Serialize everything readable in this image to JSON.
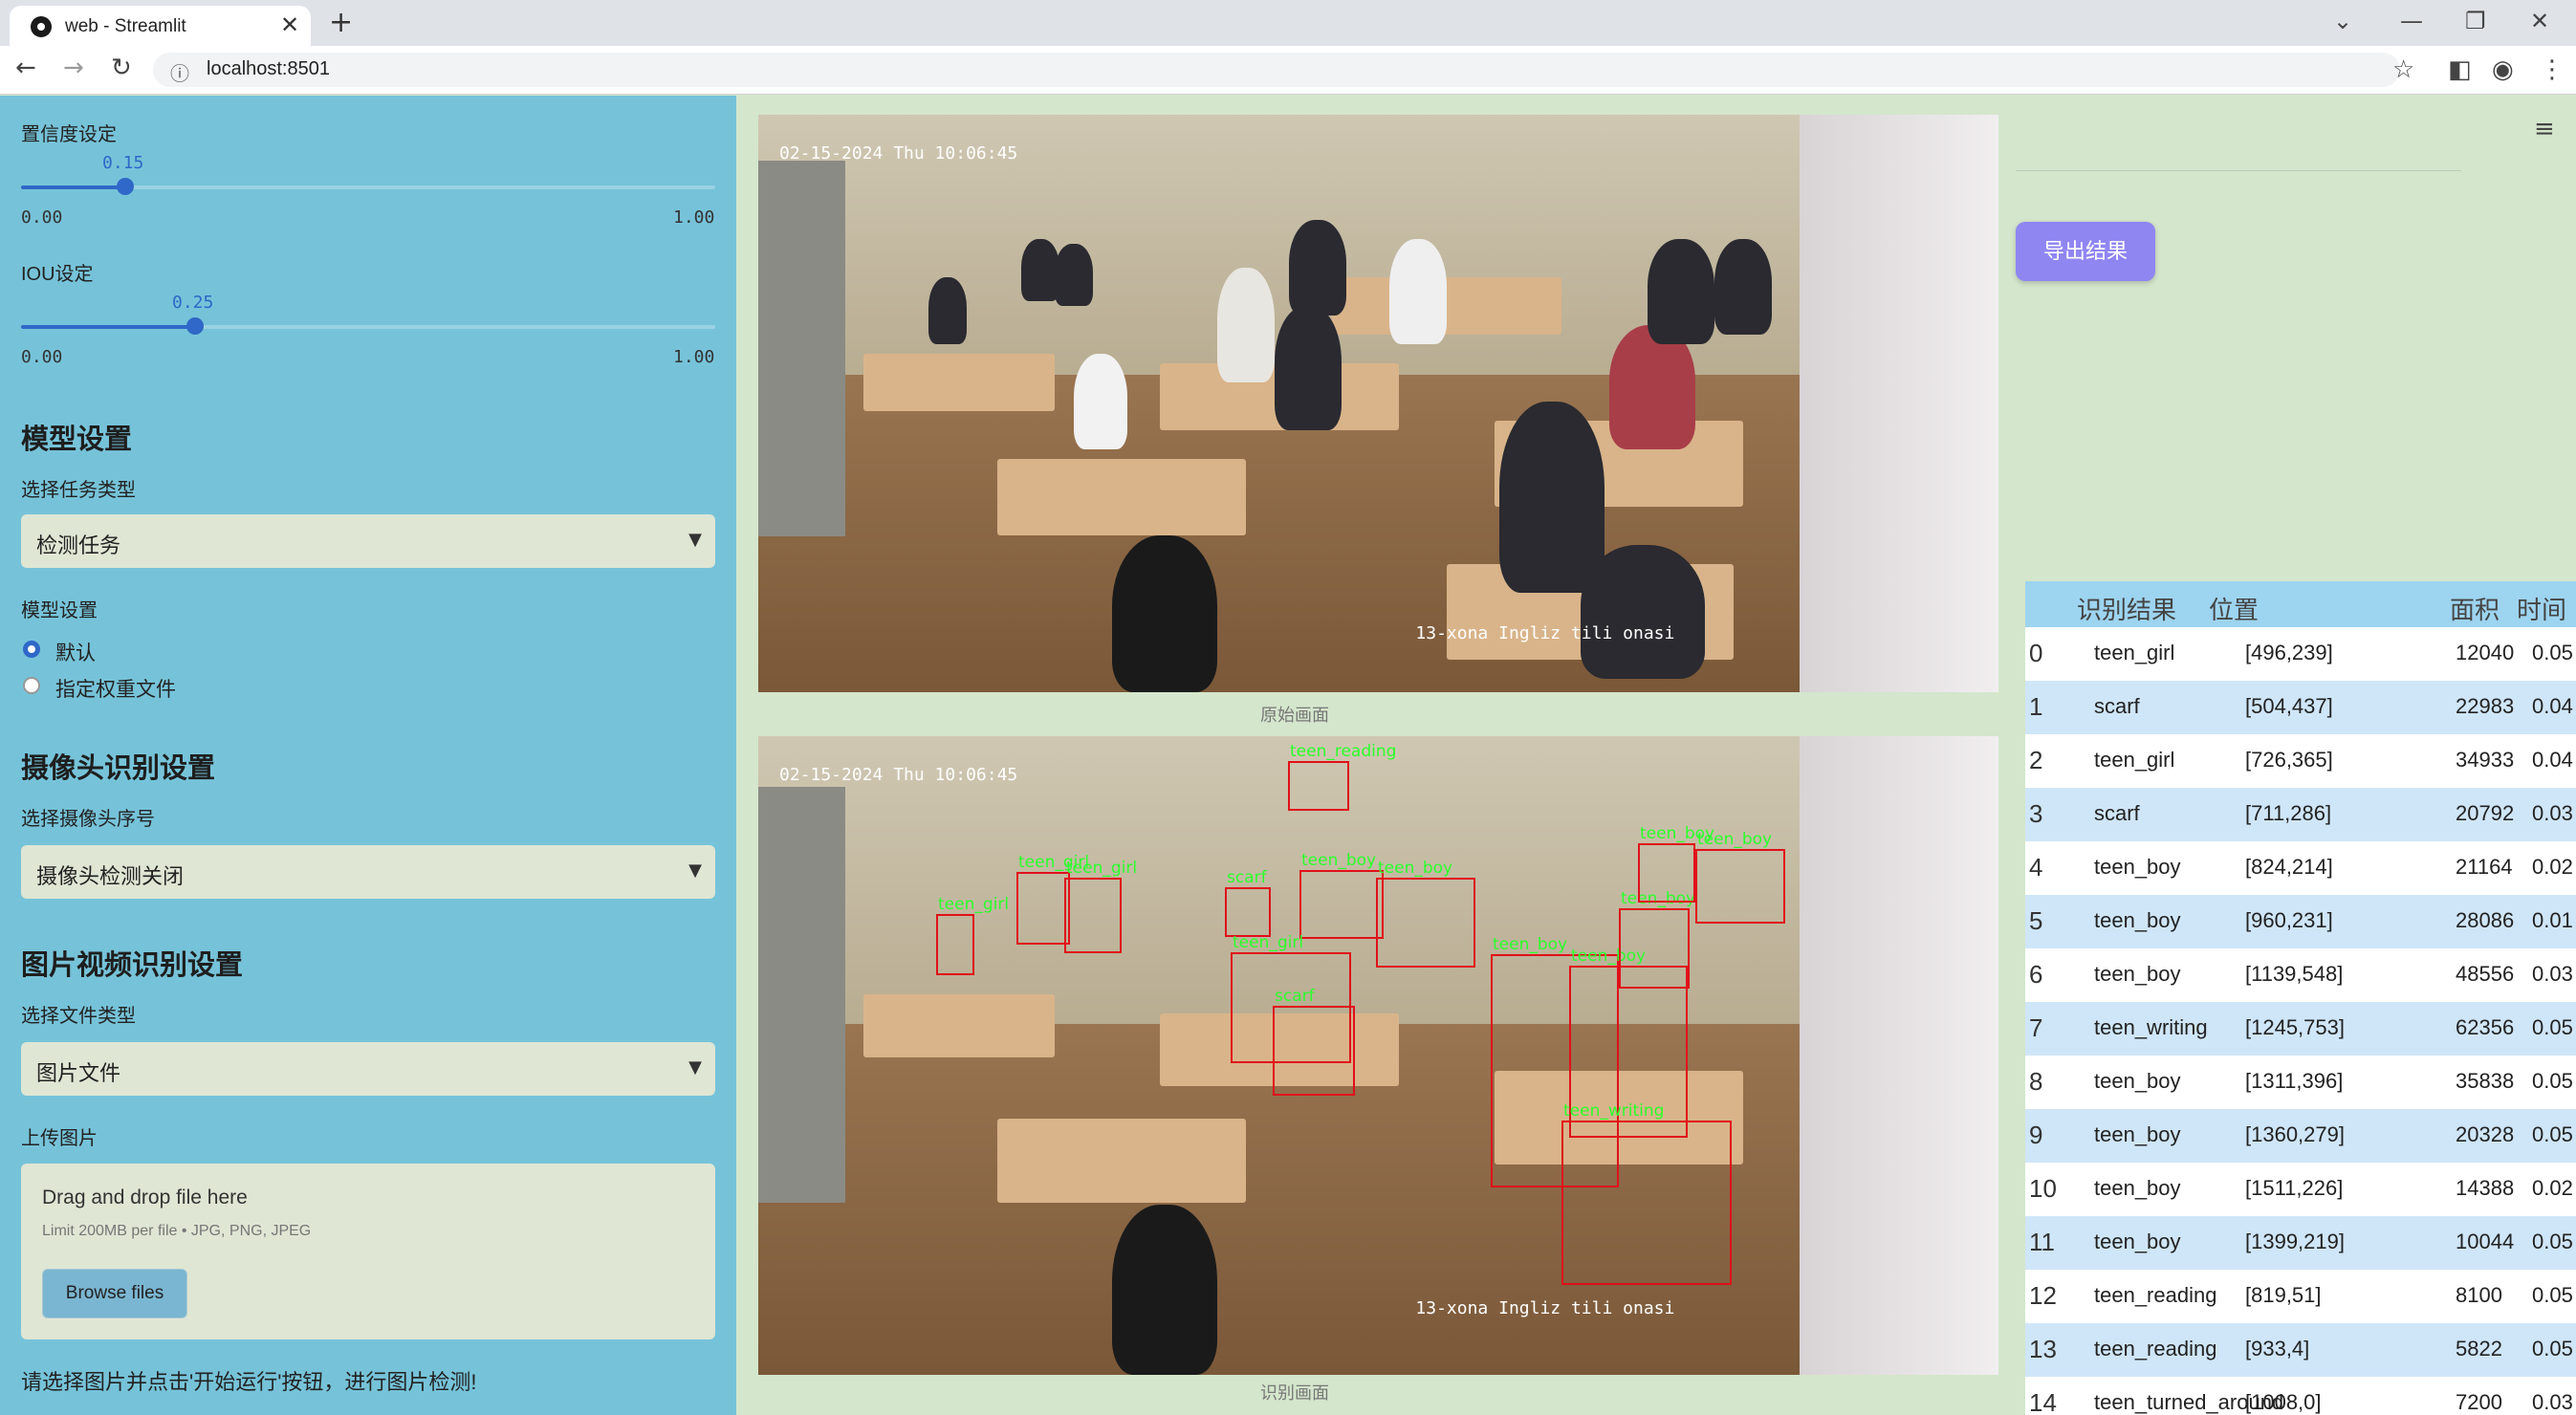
{
  "browser": {
    "tab_title": "web - Streamlit",
    "url": "localhost:8501"
  },
  "sidebar": {
    "confidence": {
      "label": "置信度设定",
      "value": "0.15",
      "min": "0.00",
      "max": "1.00",
      "fraction": 0.15
    },
    "iou": {
      "label": "IOU设定",
      "value": "0.25",
      "min": "0.00",
      "max": "1.00",
      "fraction": 0.25
    },
    "model_section": {
      "title": "模型设置",
      "task_label": "选择任务类型",
      "task_value": "检测任务",
      "model_label": "模型设置",
      "options": [
        "默认",
        "指定权重文件"
      ],
      "selected": 0
    },
    "camera_section": {
      "title": "摄像头识别设置",
      "camera_label": "选择摄像头序号",
      "camera_value": "摄像头检测关闭"
    },
    "media_section": {
      "title": "图片视频识别设置",
      "file_type_label": "选择文件类型",
      "file_type_value": "图片文件",
      "upload_label": "上传图片",
      "drop_text": "Drag and drop file here",
      "limit_text": "Limit 200MB per file • JPG, PNG, JPEG",
      "browse_label": "Browse files"
    },
    "hint": "请选择图片并点击'开始运行'按钮，进行图片检测!"
  },
  "main": {
    "timestamp": "02-15-2024 Thu 10:06:45",
    "video_caption": "13-xona Ingliz tili onasi",
    "original_caption": "原始画面",
    "result_caption": "识别画面",
    "detections": [
      {
        "label": "teen_girl"
      },
      {
        "label": "teen_girl"
      },
      {
        "label": "teen_girl"
      },
      {
        "label": "teen_reading"
      },
      {
        "label": "teen_boy"
      },
      {
        "label": "teen_boy"
      },
      {
        "label": "scarf"
      },
      {
        "label": "teen_girl"
      },
      {
        "label": "scarf"
      },
      {
        "label": "teen_boy"
      },
      {
        "label": "teen_boy"
      },
      {
        "label": "teen_boy"
      },
      {
        "label": "teen_boy"
      },
      {
        "label": "teen_boy"
      },
      {
        "label": "teen_writing"
      }
    ]
  },
  "right": {
    "export_label": "导出结果",
    "columns": [
      "识别结果",
      "位置",
      "面积",
      "时间"
    ],
    "rows": [
      {
        "idx": "0",
        "result": "teen_girl",
        "pos": "[496,239]",
        "area": "12040",
        "time": "0.05"
      },
      {
        "idx": "1",
        "result": "scarf",
        "pos": "[504,437]",
        "area": "22983",
        "time": "0.04"
      },
      {
        "idx": "2",
        "result": "teen_girl",
        "pos": "[726,365]",
        "area": "34933",
        "time": "0.04"
      },
      {
        "idx": "3",
        "result": "scarf",
        "pos": "[711,286]",
        "area": "20792",
        "time": "0.03"
      },
      {
        "idx": "4",
        "result": "teen_boy",
        "pos": "[824,214]",
        "area": "21164",
        "time": "0.02"
      },
      {
        "idx": "5",
        "result": "teen_boy",
        "pos": "[960,231]",
        "area": "28086",
        "time": "0.01"
      },
      {
        "idx": "6",
        "result": "teen_boy",
        "pos": "[1139,548]",
        "area": "48556",
        "time": "0.03"
      },
      {
        "idx": "7",
        "result": "teen_writing",
        "pos": "[1245,753]",
        "area": "62356",
        "time": "0.05"
      },
      {
        "idx": "8",
        "result": "teen_boy",
        "pos": "[1311,396]",
        "area": "35838",
        "time": "0.05"
      },
      {
        "idx": "9",
        "result": "teen_boy",
        "pos": "[1360,279]",
        "area": "20328",
        "time": "0.05"
      },
      {
        "idx": "10",
        "result": "teen_boy",
        "pos": "[1511,226]",
        "area": "14388",
        "time": "0.02"
      },
      {
        "idx": "11",
        "result": "teen_boy",
        "pos": "[1399,219]",
        "area": "10044",
        "time": "0.05"
      },
      {
        "idx": "12",
        "result": "teen_reading",
        "pos": "[819,51]",
        "area": "8100",
        "time": "0.05"
      },
      {
        "idx": "13",
        "result": "teen_reading",
        "pos": "[933,4]",
        "area": "5822",
        "time": "0.05"
      },
      {
        "idx": "14",
        "result": "teen_turned_around",
        "pos": "[1008,0]",
        "area": "7200",
        "time": "0.03"
      }
    ]
  },
  "colors": {
    "sidebar_bg": "#76c3d9",
    "main_bg": "#d4e6cc",
    "accent": "#2f68c8",
    "export_button": "#8f86f2",
    "box": "#e0101a",
    "box_label": "#2cff2c"
  }
}
